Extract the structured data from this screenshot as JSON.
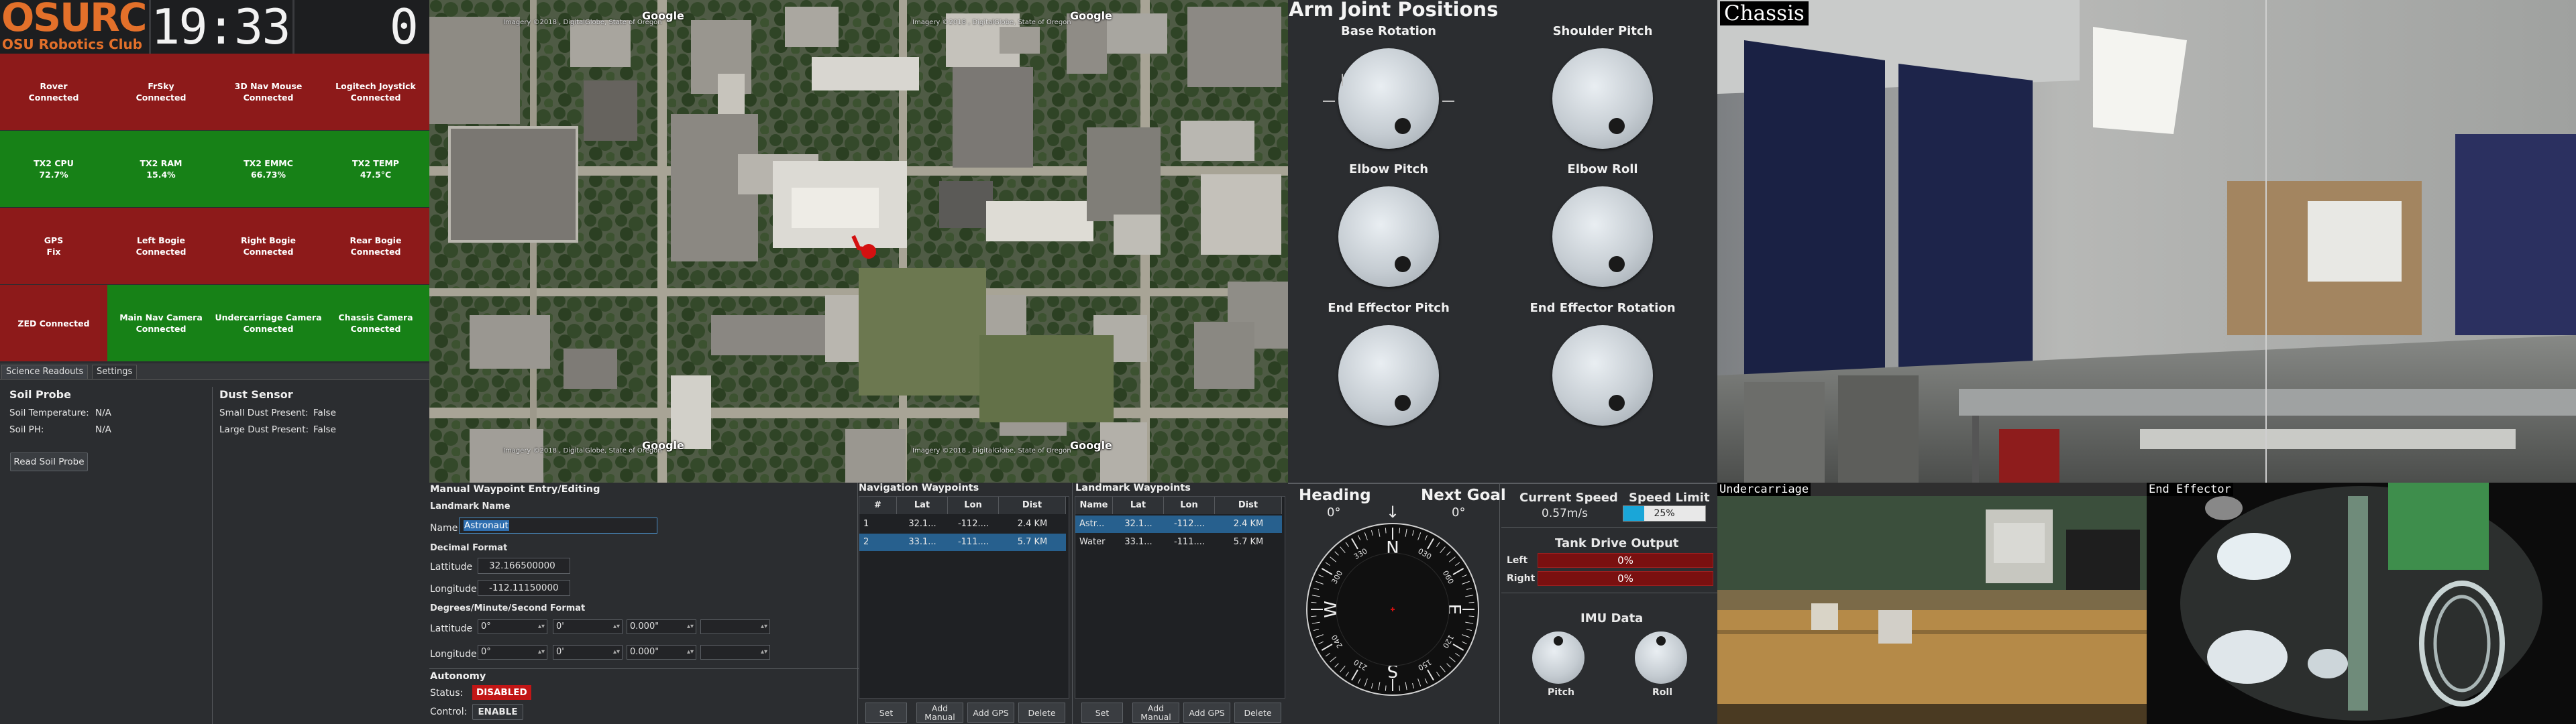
{
  "header": {
    "logo": "OSURC",
    "logo_sub": "OSU Robotics Club",
    "clock": "19:33",
    "counter": "0"
  },
  "status_tiles": [
    {
      "name": "Rover",
      "value": "Connected",
      "color": "#8d1a1a"
    },
    {
      "name": "FrSky",
      "value": "Connected",
      "color": "#8d1a1a"
    },
    {
      "name": "3D Nav Mouse",
      "value": "Connected",
      "color": "#8d1a1a"
    },
    {
      "name": "Logitech Joystick",
      "value": "Connected",
      "color": "#8d1a1a"
    },
    {
      "name": "TX2 CPU",
      "value": "72.7%",
      "color": "#178117"
    },
    {
      "name": "TX2 RAM",
      "value": "15.4%",
      "color": "#178117"
    },
    {
      "name": "TX2 EMMC",
      "value": "66.73%",
      "color": "#178117"
    },
    {
      "name": "TX2 TEMP",
      "value": "47.5°C",
      "color": "#178117"
    },
    {
      "name": "GPS",
      "value": "Fix",
      "color": "#8d1a1a"
    },
    {
      "name": "Left Bogie",
      "value": "Connected",
      "color": "#8d1a1a"
    },
    {
      "name": "Right Bogie",
      "value": "Connected",
      "color": "#8d1a1a"
    },
    {
      "name": "Rear Bogie",
      "value": "Connected",
      "color": "#8d1a1a"
    },
    {
      "name": "ZED Connected",
      "value": "",
      "color": "#8d1a1a"
    },
    {
      "name": "Main Nav Camera",
      "value": "Connected",
      "color": "#178117"
    },
    {
      "name": "Undercarriage Camera",
      "value": "Connected",
      "color": "#178117"
    },
    {
      "name": "Chassis Camera",
      "value": "Connected",
      "color": "#178117"
    }
  ],
  "tabs": {
    "science": "Science Readouts",
    "settings": "Settings"
  },
  "science": {
    "soil_title": "Soil Probe",
    "soil_temp_label": "Soil Temperature:",
    "soil_temp_value": "N/A",
    "soil_ph_label": "Soil PH:",
    "soil_ph_value": "N/A",
    "dust_title": "Dust Sensor",
    "small_dust_label": "Small Dust Present:",
    "small_dust_value": "False",
    "large_dust_label": "Large Dust Present:",
    "large_dust_value": "False",
    "read_button": "Read Soil Probe"
  },
  "map": {
    "google": "Google",
    "imagery": "Imagery ©2018 , DigitalGlobe, State of Oregon"
  },
  "waypoint_entry": {
    "title": "Manual Waypoint Entry/Editing",
    "landmark_name": "Landmark Name",
    "name_label": "Name",
    "name_value": "Astronaut",
    "decimal_title": "Decimal Format",
    "lat_label": "Lattitude",
    "lat_value": "32.166500000",
    "lon_label": "Longitude",
    "lon_value": "-112.11150000",
    "dms_title": "Degrees/Minute/Second Format",
    "dms_lat": [
      "0°",
      "0'",
      "0.000\"",
      ""
    ],
    "dms_lon": [
      "0°",
      "0'",
      "0.000\"",
      ""
    ]
  },
  "autonomy": {
    "title": "Autonomy",
    "status_label": "Status:",
    "status_value": "DISABLED",
    "control_label": "Control:",
    "control_value": "ENABLE"
  },
  "nav_waypoints": {
    "title": "Navigation Waypoints",
    "columns": [
      "#",
      "Lat",
      "Lon",
      "Dist"
    ],
    "rows": [
      [
        "1",
        "32.1...",
        "-112....",
        "2.4 KM"
      ],
      [
        "2",
        "33.1...",
        "-111....",
        "5.7 KM"
      ]
    ],
    "buttons": [
      "Set",
      "Add Manual",
      "Add GPS",
      "Delete"
    ]
  },
  "landmark_waypoints": {
    "title": "Landmark Waypoints",
    "columns": [
      "Name",
      "Lat",
      "Lon",
      "Dist"
    ],
    "rows": [
      [
        "Astr...",
        "32.1...",
        "-112....",
        "2.4 KM"
      ],
      [
        "Water",
        "33.1...",
        "-111....",
        "5.7 KM"
      ]
    ],
    "buttons": [
      "Set",
      "Add Manual",
      "Add GPS",
      "Delete"
    ]
  },
  "arm": {
    "title": "Arm Joint Positions",
    "joints": [
      "Base Rotation",
      "Shoulder Pitch",
      "Elbow Pitch",
      "Elbow Roll",
      "End Effector Pitch",
      "End Effector Rotation"
    ]
  },
  "nav": {
    "heading_label": "Heading",
    "heading_value": "0°",
    "next_goal_label": "Next Goal",
    "next_goal_value": "0°",
    "arrow": "↓",
    "current_speed_label": "Current Speed",
    "current_speed_value": "0.57m/s",
    "speed_limit_label": "Speed Limit",
    "speed_limit_value": "25%",
    "speed_limit_fraction": 0.25,
    "tank_title": "Tank Drive Output",
    "left_label": "Left",
    "left_value": "0%",
    "right_label": "Right",
    "right_value": "0%",
    "imu_title": "IMU Data",
    "pitch_label": "Pitch",
    "roll_label": "Roll",
    "compass_letters": [
      "N",
      "E",
      "S",
      "W"
    ],
    "compass_numbers": [
      "030",
      "060",
      "120",
      "150",
      "210",
      "240",
      "300",
      "330"
    ]
  },
  "cameras": {
    "main": "Chassis",
    "under": "Undercarriage",
    "effector": "End Effector"
  },
  "colors": {
    "brand": "#e3702a",
    "red_tile": "#8d1a1a",
    "green_tile": "#178117",
    "selection": "#27608e",
    "speed_fill": "#1aa6d8"
  }
}
